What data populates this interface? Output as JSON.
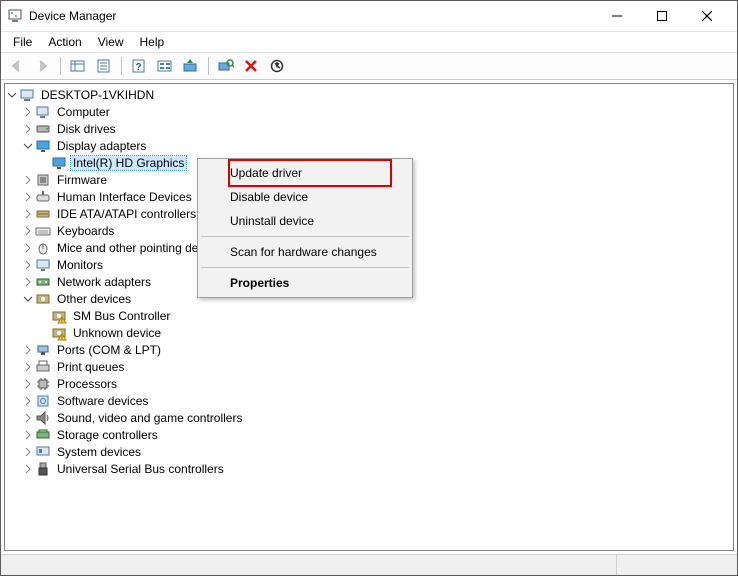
{
  "window": {
    "title": "Device Manager"
  },
  "menus": {
    "file": "File",
    "action": "Action",
    "view": "View",
    "help": "Help"
  },
  "root_node": "DESKTOP-1VKIHDN",
  "selected_device": "Intel(R) HD Graphics",
  "categories": [
    {
      "key": "computer",
      "label": "Computer",
      "expanded": false
    },
    {
      "key": "disk",
      "label": "Disk drives",
      "expanded": false
    },
    {
      "key": "display",
      "label": "Display adapters",
      "expanded": true
    },
    {
      "key": "firmware",
      "label": "Firmware",
      "expanded": false
    },
    {
      "key": "hid",
      "label": "Human Interface Devices",
      "expanded": false
    },
    {
      "key": "ide",
      "label": "IDE ATA/ATAPI controllers",
      "expanded": false
    },
    {
      "key": "keyboards",
      "label": "Keyboards",
      "expanded": false
    },
    {
      "key": "mice",
      "label": "Mice and other pointing devices",
      "expanded": false
    },
    {
      "key": "monitors",
      "label": "Monitors",
      "expanded": false
    },
    {
      "key": "network",
      "label": "Network adapters",
      "expanded": false
    },
    {
      "key": "other",
      "label": "Other devices",
      "expanded": true
    },
    {
      "key": "ports",
      "label": "Ports (COM & LPT)",
      "expanded": false
    },
    {
      "key": "printq",
      "label": "Print queues",
      "expanded": false
    },
    {
      "key": "proc",
      "label": "Processors",
      "expanded": false
    },
    {
      "key": "softdev",
      "label": "Software devices",
      "expanded": false
    },
    {
      "key": "sound",
      "label": "Sound, video and game controllers",
      "expanded": false
    },
    {
      "key": "storage",
      "label": "Storage controllers",
      "expanded": false
    },
    {
      "key": "system",
      "label": "System devices",
      "expanded": false
    },
    {
      "key": "usb",
      "label": "Universal Serial Bus controllers",
      "expanded": false
    }
  ],
  "other_devices": [
    {
      "label": "SM Bus Controller"
    },
    {
      "label": "Unknown device"
    }
  ],
  "context_menu": {
    "update": "Update driver",
    "disable": "Disable device",
    "uninstall": "Uninstall device",
    "scan": "Scan for hardware changes",
    "properties": "Properties"
  }
}
